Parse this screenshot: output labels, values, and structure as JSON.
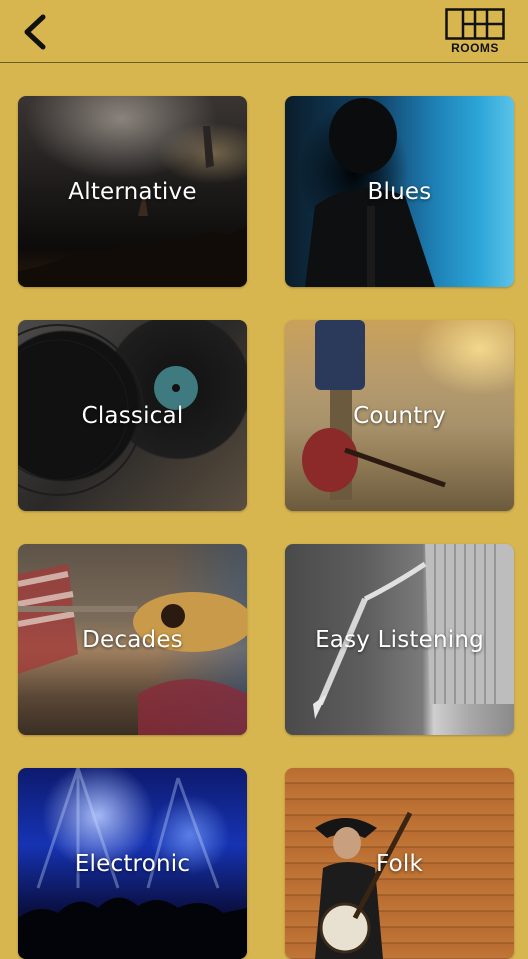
{
  "header": {
    "back_icon": "chevron-left-icon",
    "logo_text": "ROOMS"
  },
  "genres": [
    {
      "label": "Alternative"
    },
    {
      "label": "Blues"
    },
    {
      "label": "Classical"
    },
    {
      "label": "Country"
    },
    {
      "label": "Decades"
    },
    {
      "label": "Easy Listening"
    },
    {
      "label": "Electronic"
    },
    {
      "label": "Folk"
    }
  ],
  "colors": {
    "background": "#d7b54f",
    "tile_text": "#ffffff"
  }
}
